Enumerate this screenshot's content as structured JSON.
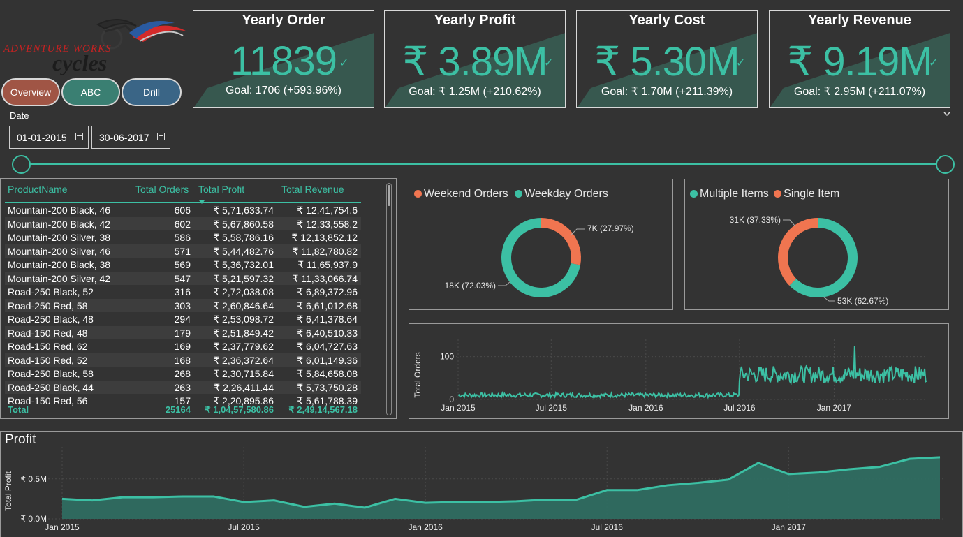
{
  "logo": {
    "line1": "ADVENTURE WORKS",
    "line2": "cycles"
  },
  "nav": [
    {
      "label": "Overview",
      "color": "#a05545"
    },
    {
      "label": "ABC",
      "color": "#3a7f72"
    },
    {
      "label": "Drill",
      "color": "#3a6586"
    }
  ],
  "kpis": [
    {
      "title": "Yearly Order",
      "value": "11839",
      "goal": "Goal: 1706 (+593.96%)"
    },
    {
      "title": "Yearly Profit",
      "value": "₹ 3.89M",
      "goal": "Goal: ₹ 1.25M (+210.62%)"
    },
    {
      "title": "Yearly Cost",
      "value": "₹ 5.30M",
      "goal": "Goal: ₹ 1.70M (+211.39%)"
    },
    {
      "title": "Yearly Revenue",
      "value": "₹ 9.19M",
      "goal": "Goal: ₹ 2.95M (+211.07%)"
    }
  ],
  "check_glyph": "✓",
  "date_filter": {
    "label": "Date",
    "start": "01-01-2015",
    "end": "30-06-2017"
  },
  "table": {
    "headers": [
      "ProductName",
      "Total Orders",
      "Total Profit",
      "Total Revenue"
    ],
    "rows": [
      [
        "Mountain-200 Black, 46",
        "606",
        "₹ 5,71,633.74",
        "₹ 12,41,754.6"
      ],
      [
        "Mountain-200 Black, 42",
        "602",
        "₹ 5,67,860.58",
        "₹ 12,33,558.2"
      ],
      [
        "Mountain-200 Silver, 38",
        "586",
        "₹ 5,58,786.16",
        "₹ 12,13,852.12"
      ],
      [
        "Mountain-200 Silver, 46",
        "571",
        "₹ 5,44,482.76",
        "₹ 11,82,780.82"
      ],
      [
        "Mountain-200 Black, 38",
        "569",
        "₹ 5,36,732.01",
        "₹ 11,65,937.9"
      ],
      [
        "Mountain-200 Silver, 42",
        "547",
        "₹ 5,21,597.32",
        "₹ 11,33,066.74"
      ],
      [
        "Road-250 Black, 52",
        "316",
        "₹ 2,72,038.08",
        "₹ 6,89,372.96"
      ],
      [
        "Road-250 Red, 58",
        "303",
        "₹ 2,60,846.64",
        "₹ 6,61,012.68"
      ],
      [
        "Road-250 Black, 48",
        "294",
        "₹ 2,53,098.72",
        "₹ 6,41,378.64"
      ],
      [
        "Road-150 Red, 48",
        "179",
        "₹ 2,51,849.42",
        "₹ 6,40,510.33"
      ],
      [
        "Road-150 Red, 62",
        "169",
        "₹ 2,37,779.62",
        "₹ 6,04,727.63"
      ],
      [
        "Road-150 Red, 52",
        "168",
        "₹ 2,36,372.64",
        "₹ 6,01,149.36"
      ],
      [
        "Road-250 Black, 58",
        "268",
        "₹ 2,30,715.84",
        "₹ 5,84,658.08"
      ],
      [
        "Road-250 Black, 44",
        "263",
        "₹ 2,26,411.44",
        "₹ 5,73,750.28"
      ],
      [
        "Road-150 Red, 56",
        "157",
        "₹ 2,20,895.86",
        "₹ 5,61,788.39"
      ]
    ],
    "total": [
      "Total",
      "25164",
      "₹ 1,04,57,580.86",
      "₹ 2,49,14,567.18"
    ]
  },
  "chart_data": [
    {
      "type": "pie",
      "legend": [
        "Weekend Orders",
        "Weekday Orders"
      ],
      "labels": [
        "Weekend Orders",
        "Weekday Orders"
      ],
      "values": [
        27.97,
        72.03
      ],
      "data_labels": [
        "7K (27.97%)",
        "18K (72.03%)"
      ],
      "colors": [
        "#f07550",
        "#3cc0a4"
      ]
    },
    {
      "type": "pie",
      "legend": [
        "Multiple Items",
        "Single Item"
      ],
      "labels": [
        "Multiple Items",
        "Single Item"
      ],
      "values": [
        62.67,
        37.33
      ],
      "data_labels": [
        "53K (62.67%)",
        "31K (37.33%)"
      ],
      "colors": [
        "#3cc0a4",
        "#f07550"
      ]
    },
    {
      "type": "line",
      "ylabel": "Total Orders",
      "x_ticks": [
        "Jan 2015",
        "Jul 2015",
        "Jan 2016",
        "Jul 2016",
        "Jan 2017"
      ],
      "y_ticks": [
        "0",
        "100"
      ],
      "ylim": [
        0,
        140
      ],
      "xlim": [
        "2015-01-01",
        "2017-06-30"
      ],
      "series": [
        {
          "segments": [
            {
              "from": "2015-01-01",
              "to": "2016-06-30",
              "level": 10,
              "noise": 5
            },
            {
              "from": "2016-07-01",
              "to": "2017-06-30",
              "level": 58,
              "noise": 20,
              "spike": {
                "at": "2017-02-10",
                "value": 125
              }
            }
          ]
        }
      ],
      "color": "#3cc0a4"
    },
    {
      "type": "area",
      "title": "Profit",
      "ylabel": "Total Profit",
      "x_ticks": [
        "Jan 2015",
        "Jul 2015",
        "Jan 2016",
        "Jul 2016",
        "Jan 2017"
      ],
      "y_ticks": [
        "₹ 0.0M",
        "₹ 0.5M"
      ],
      "ylim": [
        0,
        0.9
      ],
      "x": [
        "2015-01",
        "2015-02",
        "2015-03",
        "2015-04",
        "2015-05",
        "2015-06",
        "2015-07",
        "2015-08",
        "2015-09",
        "2015-10",
        "2015-11",
        "2015-12",
        "2016-01",
        "2016-02",
        "2016-03",
        "2016-04",
        "2016-05",
        "2016-06",
        "2016-07",
        "2016-08",
        "2016-09",
        "2016-10",
        "2016-11",
        "2016-12",
        "2017-01",
        "2017-02",
        "2017-03",
        "2017-04",
        "2017-05",
        "2017-06"
      ],
      "values": [
        0.25,
        0.23,
        0.27,
        0.27,
        0.28,
        0.28,
        0.21,
        0.23,
        0.15,
        0.19,
        0.14,
        0.25,
        0.2,
        0.21,
        0.21,
        0.22,
        0.24,
        0.24,
        0.36,
        0.36,
        0.42,
        0.45,
        0.49,
        0.7,
        0.56,
        0.58,
        0.62,
        0.65,
        0.75,
        0.77
      ],
      "color": "#3cc0a4"
    }
  ]
}
